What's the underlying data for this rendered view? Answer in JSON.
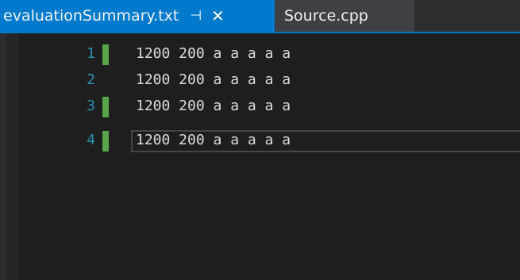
{
  "tabs": [
    {
      "label": "evaluationSummary.txt",
      "active": true,
      "pinned_icon": "pin-icon",
      "close_icon": "close-icon"
    },
    {
      "label": "Source.cpp",
      "active": false
    }
  ],
  "tab_glyphs": {
    "pin": "⊣",
    "close": "✕"
  },
  "editor": {
    "current_line": 4,
    "lines": [
      {
        "number": "1",
        "text": "1200 200 a a a a a",
        "changed": true
      },
      {
        "number": "2",
        "text": "1200 200 a a a a a",
        "changed": false
      },
      {
        "number": "3",
        "text": "1200 200 a a a a a",
        "changed": true
      },
      {
        "number": "4",
        "text": "1200 200 a a a a a",
        "changed": true
      }
    ]
  },
  "colors": {
    "accent": "#007acc",
    "background": "#1e1e1e",
    "line_number": "#2b91af",
    "change_bar": "#57a64a",
    "text": "#dcdcdc"
  }
}
